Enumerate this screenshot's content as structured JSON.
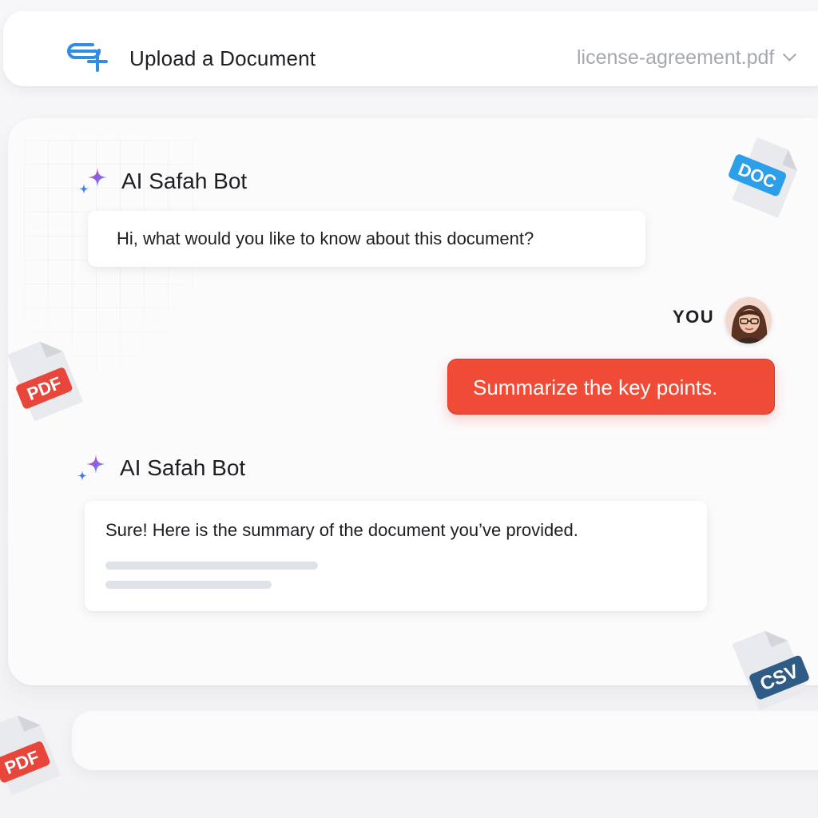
{
  "header": {
    "title": "Upload a Document",
    "file_selected": "license-agreement.pdf",
    "upload_icon": "upload-document-icon",
    "dropdown_icon": "chevron-down-icon"
  },
  "chat": {
    "messages": [
      {
        "sender": "AI Safah Bot",
        "icon": "sparkle-icon",
        "text": "Hi, what would you like to know about this document?"
      },
      {
        "sender": "YOU",
        "avatar": "user-avatar",
        "text": "Summarize the key points."
      },
      {
        "sender": "AI Safah Bot",
        "icon": "sparkle-icon",
        "text": "Sure! Here is the summary of the document you’ve provided."
      }
    ]
  },
  "file_types": [
    {
      "label": "DOC",
      "color": "#2d9ee8"
    },
    {
      "label": "PDF",
      "color": "#e8463a"
    },
    {
      "label": "CSV",
      "color": "#2f5c86"
    },
    {
      "label": "PDF",
      "color": "#e8463a"
    }
  ],
  "colors": {
    "accent_user_bubble": "#ef4b37",
    "upload_icon": "#2f8de4"
  }
}
